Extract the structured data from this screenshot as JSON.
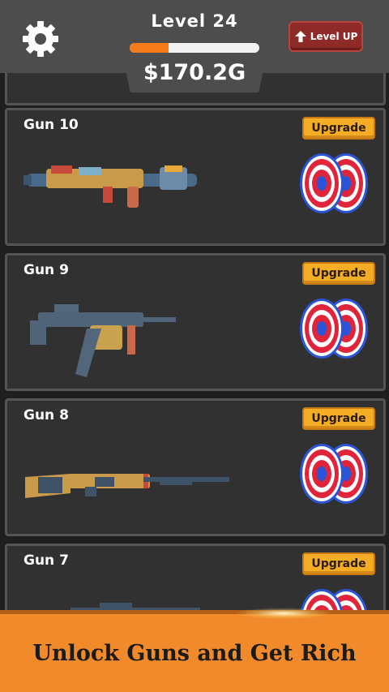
{
  "header": {
    "level_label": "Level 24",
    "progress_fraction": 0.3,
    "money": "$170.2G",
    "level_up_label": "Level UP",
    "settings_icon": "gear-icon"
  },
  "guns": [
    {
      "name": "Gun 10",
      "upgrade_label": "Upgrade",
      "icon": "rocket-launcher-icon"
    },
    {
      "name": "Gun 9",
      "upgrade_label": "Upgrade",
      "icon": "smg-icon"
    },
    {
      "name": "Gun 8",
      "upgrade_label": "Upgrade",
      "icon": "rifle-icon"
    },
    {
      "name": "Gun 7",
      "upgrade_label": "Upgrade",
      "icon": "sniper-icon"
    }
  ],
  "banner": {
    "text": "Unlock Guns and Get Rich"
  },
  "colors": {
    "accent_orange": "#f47a1a",
    "upgrade_yellow": "#f4ad24",
    "level_up_red": "#8e2a28",
    "target_red": "#e0243a",
    "target_blue": "#2a55d6"
  }
}
